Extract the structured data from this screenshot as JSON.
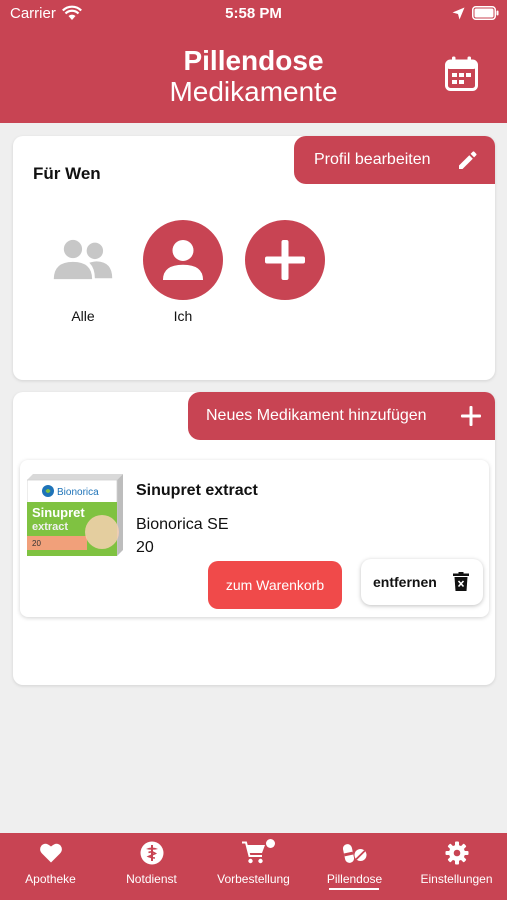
{
  "status_bar": {
    "carrier": "Carrier",
    "time": "5:58 PM"
  },
  "header": {
    "title": "Pillendose",
    "subtitle": "Medikamente",
    "calendar_icon": "calendar-icon"
  },
  "profile_section": {
    "edit_button": "Profil bearbeiten",
    "heading": "Für Wen",
    "options": [
      {
        "label": "Alle",
        "icon": "group-icon",
        "selected": false
      },
      {
        "label": "Ich",
        "icon": "person-icon",
        "selected": true
      },
      {
        "label": "",
        "icon": "plus-icon",
        "selected": false
      }
    ]
  },
  "medications": {
    "add_button": "Neues Medikament hinzufügen",
    "items": [
      {
        "name": "Sinupret extract",
        "manufacturer": "Bionorica SE",
        "quantity": "20",
        "package_brand": "Bionorica",
        "package_name": "Sinupret",
        "package_variant": "extract",
        "package_count": "20",
        "cart_button": "zum Warenkorb",
        "remove_button": "entfernen"
      }
    ]
  },
  "tabbar": {
    "items": [
      {
        "label": "Apotheke",
        "icon": "heart-icon"
      },
      {
        "label": "Notdienst",
        "icon": "caduceus-icon"
      },
      {
        "label": "Vorbestellung",
        "icon": "cart-icon",
        "badge": true
      },
      {
        "label": "Pillendose",
        "icon": "pills-icon",
        "active": true
      },
      {
        "label": "Einstellungen",
        "icon": "gear-icon"
      }
    ]
  },
  "colors": {
    "brand": "#c84453",
    "cart_button": "#f04a4a",
    "background": "#efefef",
    "inactive_icon": "#c7c7c7"
  }
}
